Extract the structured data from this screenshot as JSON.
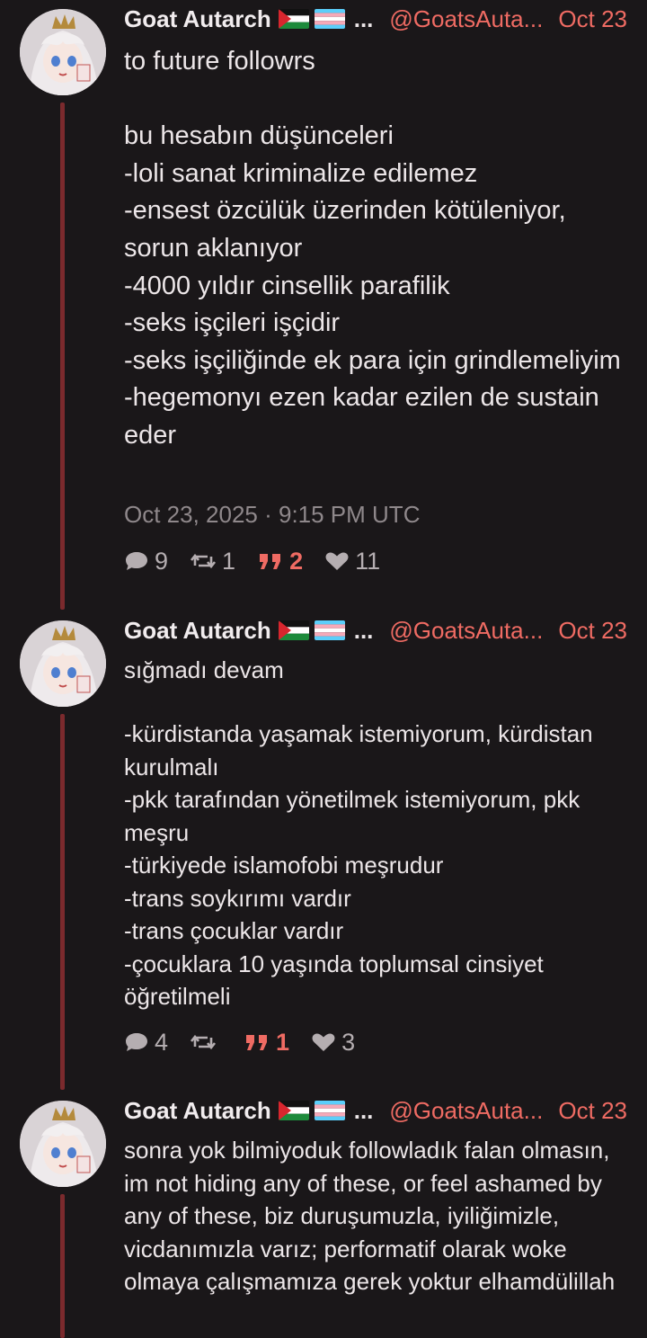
{
  "posts": [
    {
      "author_name": "Goat Autarch",
      "handle": "@GoatsAuta...",
      "date": "Oct 23",
      "body": "to future followrs\n\nbu hesabın düşünceleri\n-loli sanat kriminalize edilemez\n-ensest özcülük üzerinden kötüleniyor, sorun aklanıyor\n-4000 yıldır cinsellik parafilik\n-seks işçileri işçidir\n-seks işçiliğinde ek para için grindlemeliyim\n-hegemonyı ezen kadar ezilen de sustain eder",
      "timestamp": "Oct 23, 2025 · 9:15 PM UTC",
      "replies": "9",
      "reposts": "1",
      "quotes": "2",
      "likes": "11"
    },
    {
      "author_name": "Goat Autarch",
      "handle": "@GoatsAuta...",
      "date": "Oct 23",
      "body_first": "sığmadı devam",
      "body": "-kürdistanda yaşamak istemiyorum, kürdistan kurulmalı\n-pkk tarafından yönetilmek istemiyorum, pkk meşru\n-türkiyede islamofobi meşrudur\n-trans soykırımı vardır\n-trans çocuklar vardır\n-çocuklara 10 yaşında toplumsal cinsiyet öğretilmeli",
      "replies": "4",
      "reposts": "",
      "quotes": "1",
      "likes": "3"
    },
    {
      "author_name": "Goat Autarch",
      "handle": "@GoatsAuta...",
      "date": "Oct 23",
      "body": "sonra yok bilmiyoduk followladık falan olmasın, im not hiding any of these, or feel ashamed by any of these, biz duruşumuzla, iyiliğimizle, vicdanımızla varız; performatif olarak woke olmaya çalışmamıza gerek yoktur elhamdülillah"
    }
  ],
  "colors": {
    "background": "#1a1719",
    "accent": "#ef6b63",
    "thread_line": "#7b2a2d",
    "muted": "#8f888b"
  },
  "icons": {
    "reply": "speech-bubble-icon",
    "repost": "repost-arrows-icon",
    "quote": "quote-marks-icon",
    "like": "heart-icon",
    "flags": [
      "palestine-flag-icon",
      "transgender-flag-icon"
    ]
  }
}
